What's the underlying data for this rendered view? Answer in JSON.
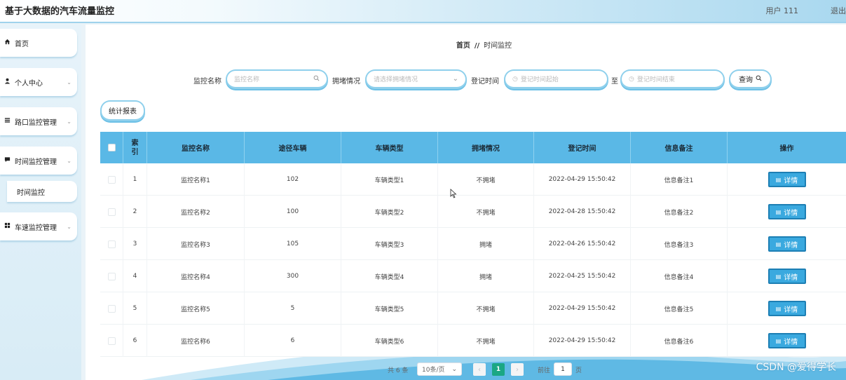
{
  "app": {
    "title": "基于大数据的汽车流量监控",
    "user": "用户 111",
    "logout": "退出"
  },
  "sidebar": {
    "items": [
      {
        "label": "首页",
        "icon": "home-icon",
        "has_children": false
      },
      {
        "label": "个人中心",
        "icon": "user-icon",
        "has_children": true
      },
      {
        "label": "路口监控管理",
        "icon": "list-icon",
        "has_children": true
      },
      {
        "label": "时间监控管理",
        "icon": "chat-icon",
        "has_children": true
      },
      {
        "label": "车速监控管理",
        "icon": "grid-icon",
        "has_children": true
      }
    ],
    "sub_item": "时间监控"
  },
  "breadcrumb": {
    "home": "首页",
    "sep": "//",
    "current": "时间监控"
  },
  "search": {
    "name_label": "监控名称",
    "name_placeholder": "监控名称",
    "congestion_label": "拥堵情况",
    "congestion_placeholder": "请选择拥堵情况",
    "time_label": "登记时间",
    "time_start_placeholder": "登记时间起始",
    "to_label": "至",
    "time_end_placeholder": "登记时间结束",
    "query_button": "查询"
  },
  "stats_button": "统计报表",
  "table": {
    "headers": [
      "索引",
      "监控名称",
      "途径车辆",
      "车辆类型",
      "拥堵情况",
      "登记时间",
      "信息备注",
      "操作"
    ],
    "detail_label": "详情",
    "rows": [
      {
        "index": "1",
        "name": "监控名称1",
        "vehicles": "102",
        "type": "车辆类型1",
        "congestion": "不拥堵",
        "time": "2022-04-29 15:50:42",
        "note": "信息备注1"
      },
      {
        "index": "2",
        "name": "监控名称2",
        "vehicles": "100",
        "type": "车辆类型2",
        "congestion": "不拥堵",
        "time": "2022-04-28 15:50:42",
        "note": "信息备注2"
      },
      {
        "index": "3",
        "name": "监控名称3",
        "vehicles": "105",
        "type": "车辆类型3",
        "congestion": "拥堵",
        "time": "2022-04-26 15:50:42",
        "note": "信息备注3"
      },
      {
        "index": "4",
        "name": "监控名称4",
        "vehicles": "300",
        "type": "车辆类型4",
        "congestion": "拥堵",
        "time": "2022-04-25 15:50:42",
        "note": "信息备注4"
      },
      {
        "index": "5",
        "name": "监控名称5",
        "vehicles": "5",
        "type": "车辆类型5",
        "congestion": "不拥堵",
        "time": "2022-04-29 15:50:42",
        "note": "信息备注5"
      },
      {
        "index": "6",
        "name": "监控名称6",
        "vehicles": "6",
        "type": "车辆类型6",
        "congestion": "不拥堵",
        "time": "2022-04-29 15:50:42",
        "note": "信息备注6"
      }
    ]
  },
  "pagination": {
    "total": "共 6 条",
    "page_size": "10条/页",
    "current_page": "1",
    "goto_label": "前往",
    "goto_value": "1",
    "goto_unit": "页"
  },
  "watermark": "CSDN @爱得学长"
}
